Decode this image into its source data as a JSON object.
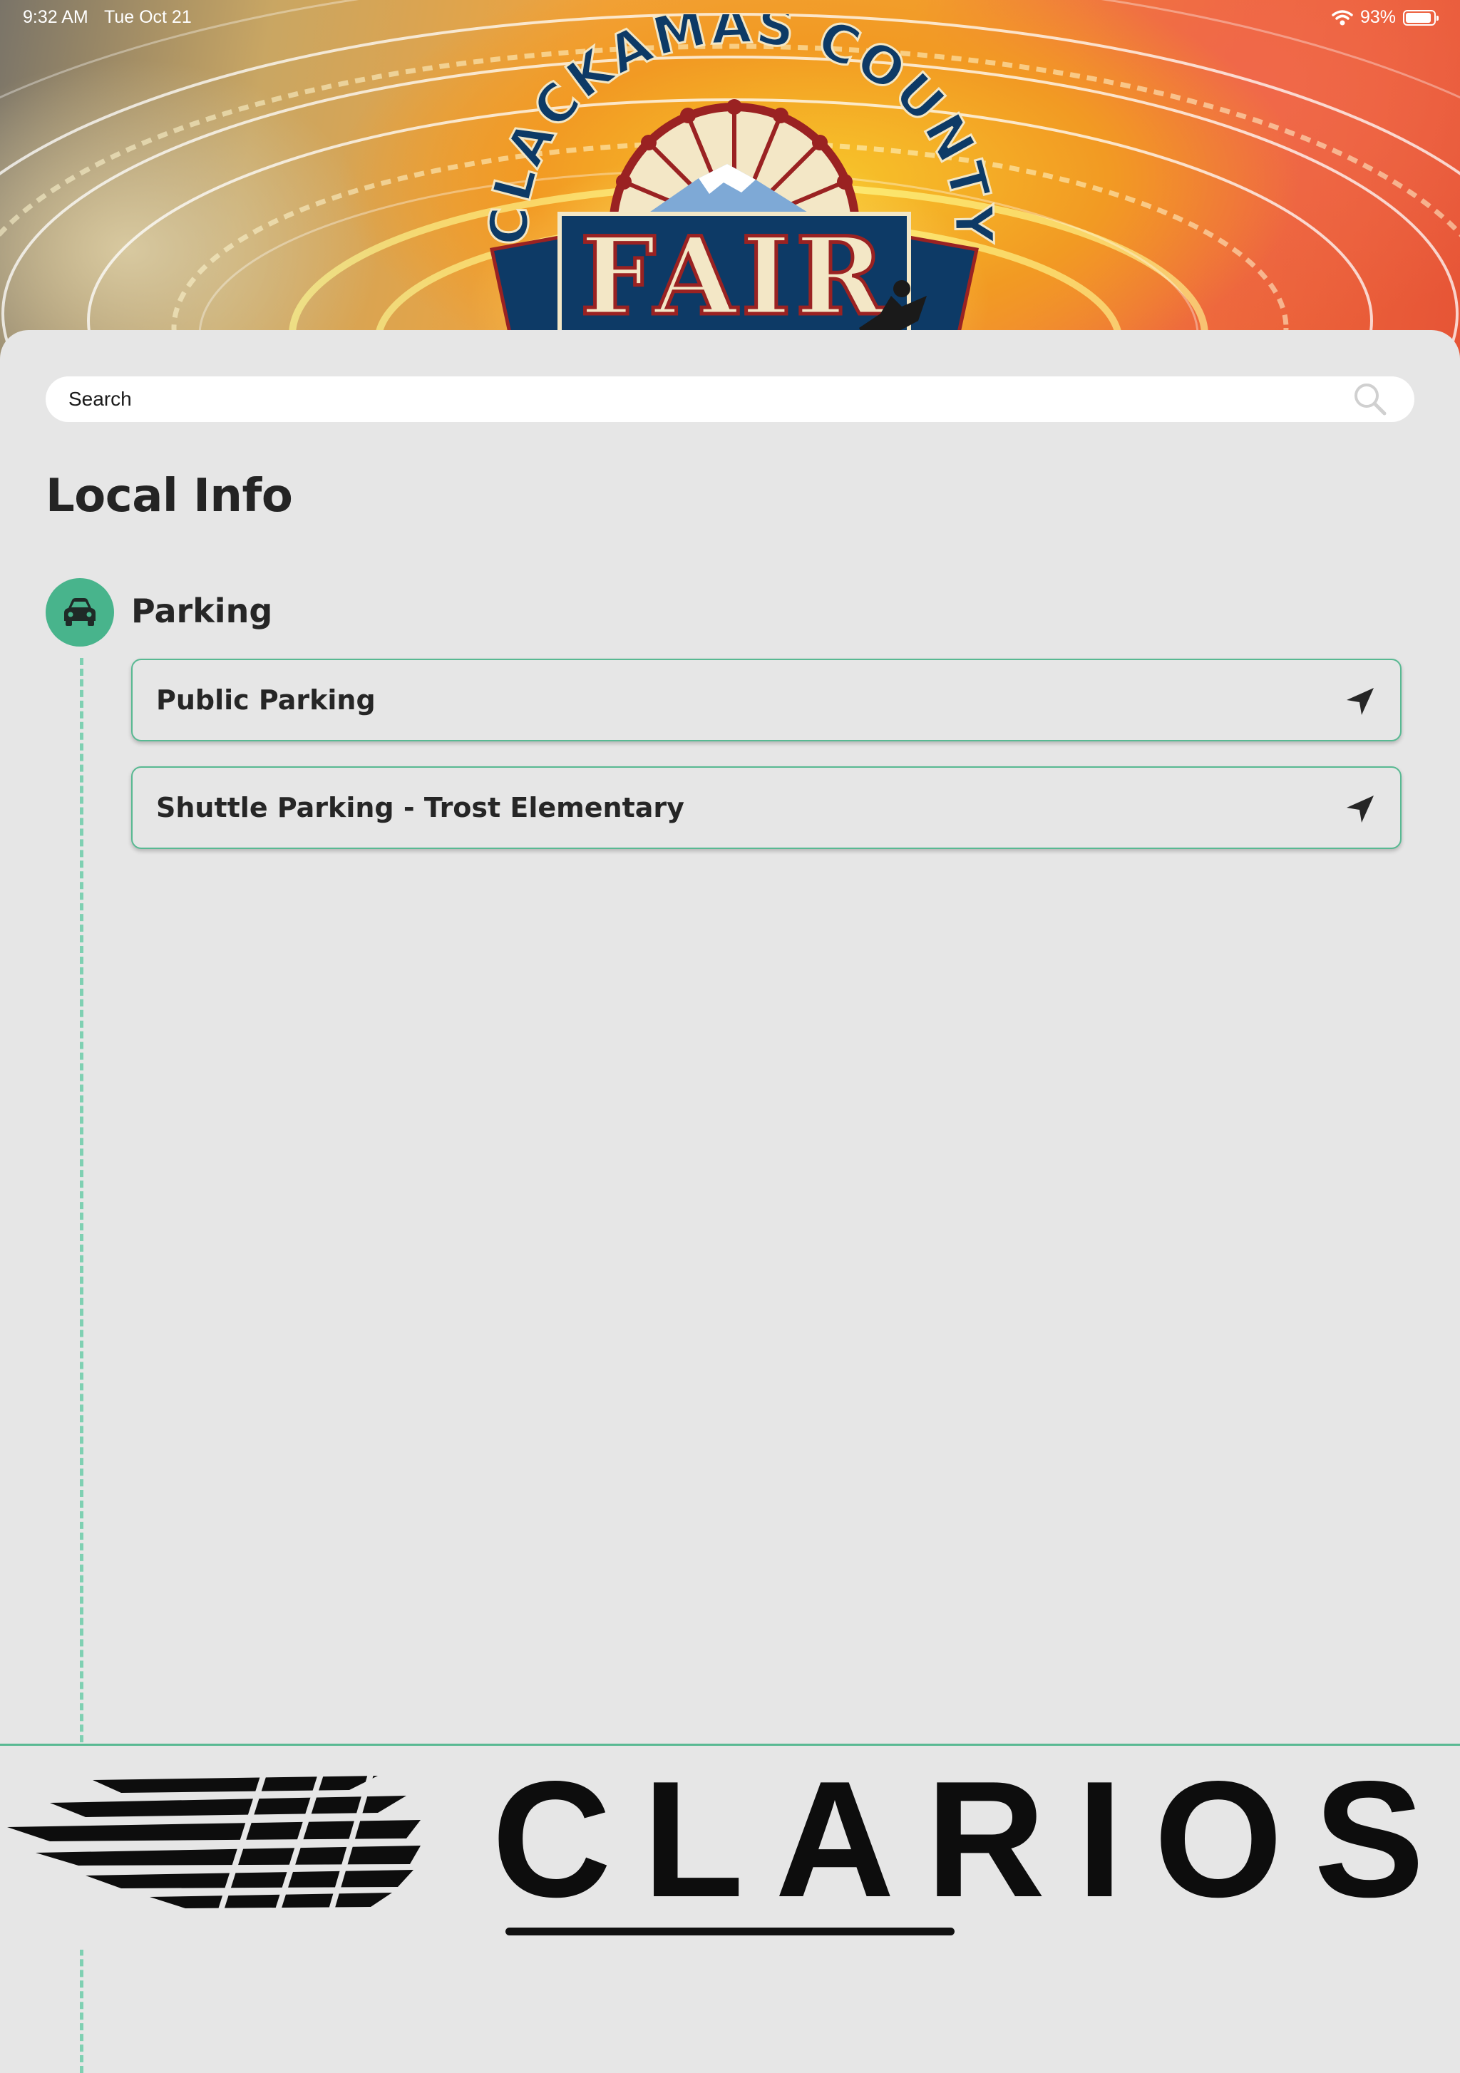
{
  "status_bar": {
    "time": "9:32 AM",
    "date": "Tue Oct 21",
    "battery": "93%",
    "battery_level": 0.93
  },
  "header": {
    "logo_top": "CLACKAMAS COUNTY",
    "logo_main": "FAIR"
  },
  "search": {
    "placeholder": "Search"
  },
  "page": {
    "title": "Local Info"
  },
  "category": {
    "label": "Parking",
    "icon": "car-icon",
    "items": [
      {
        "label": "Public Parking",
        "icon": "navigation-arrow-icon"
      },
      {
        "label": "Shuttle Parking - Trost Elementary",
        "icon": "navigation-arrow-icon"
      }
    ]
  },
  "sponsor": {
    "name": "CLARIOS"
  },
  "colors": {
    "accent": "#48b48c",
    "sheet": "#e6e6e6",
    "text": "#262626",
    "logo_navy": "#0d3a66",
    "logo_red": "#9a2222"
  }
}
